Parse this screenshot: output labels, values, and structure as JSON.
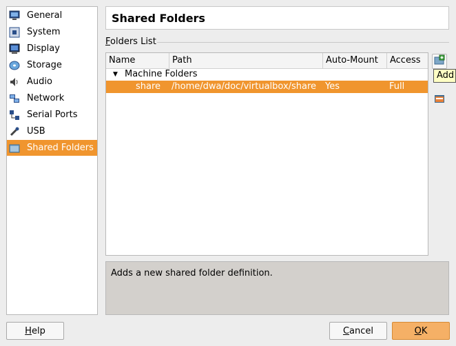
{
  "sidebar": {
    "items": [
      {
        "label": "General",
        "icon": "monitor-icon"
      },
      {
        "label": "System",
        "icon": "chip-icon"
      },
      {
        "label": "Display",
        "icon": "display-icon"
      },
      {
        "label": "Storage",
        "icon": "disc-icon"
      },
      {
        "label": "Audio",
        "icon": "speaker-icon"
      },
      {
        "label": "Network",
        "icon": "network-icon"
      },
      {
        "label": "Serial Ports",
        "icon": "serial-icon"
      },
      {
        "label": "USB",
        "icon": "usb-icon"
      },
      {
        "label": "Shared Folders",
        "icon": "folder-icon",
        "selected": true
      }
    ]
  },
  "page": {
    "title": "Shared Folders",
    "group_label_first": "F",
    "group_label_rest": "olders List"
  },
  "table": {
    "columns": [
      "Name",
      "Path",
      "Auto-Mount",
      "Access"
    ],
    "group": "Machine Folders",
    "rows": [
      {
        "name": "share",
        "path": "/home/dwa/doc/virtualbox/share",
        "auto_mount": "Yes",
        "access": "Full"
      }
    ]
  },
  "tooltip": "Add",
  "description": "Adds a new shared folder definition.",
  "buttons": {
    "help_first": "H",
    "help_rest": "elp",
    "cancel_first": "C",
    "cancel_rest": "ancel",
    "ok_first": "O",
    "ok_rest": "K"
  },
  "colors": {
    "selection": "#f0952e",
    "tooltip_bg": "#ffffc4"
  }
}
